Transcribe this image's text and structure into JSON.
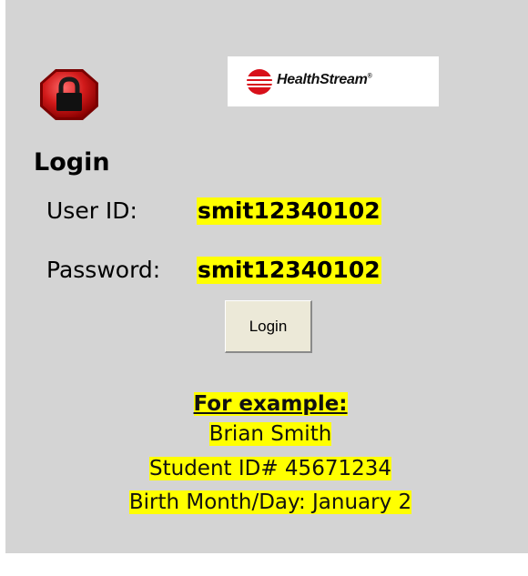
{
  "logo": {
    "name": "HealthStream",
    "reg": "®"
  },
  "icons": {
    "status": "lock-stop-icon",
    "logo_mark": "healthstream-logo-mark"
  },
  "login": {
    "heading": "Login",
    "user_id_label": "User ID:",
    "user_id_value": "smit12340102",
    "password_label": "Password:",
    "password_value": "smit12340102",
    "button_label": "Login"
  },
  "example": {
    "title": "For example:",
    "lines": [
      "Brian Smith",
      "Student ID# 45671234",
      "Birth Month/Day: January 2"
    ]
  },
  "colors": {
    "highlight": "#ffff00",
    "panel": "#d4d4d4",
    "stop_red": "#d11a1a"
  }
}
